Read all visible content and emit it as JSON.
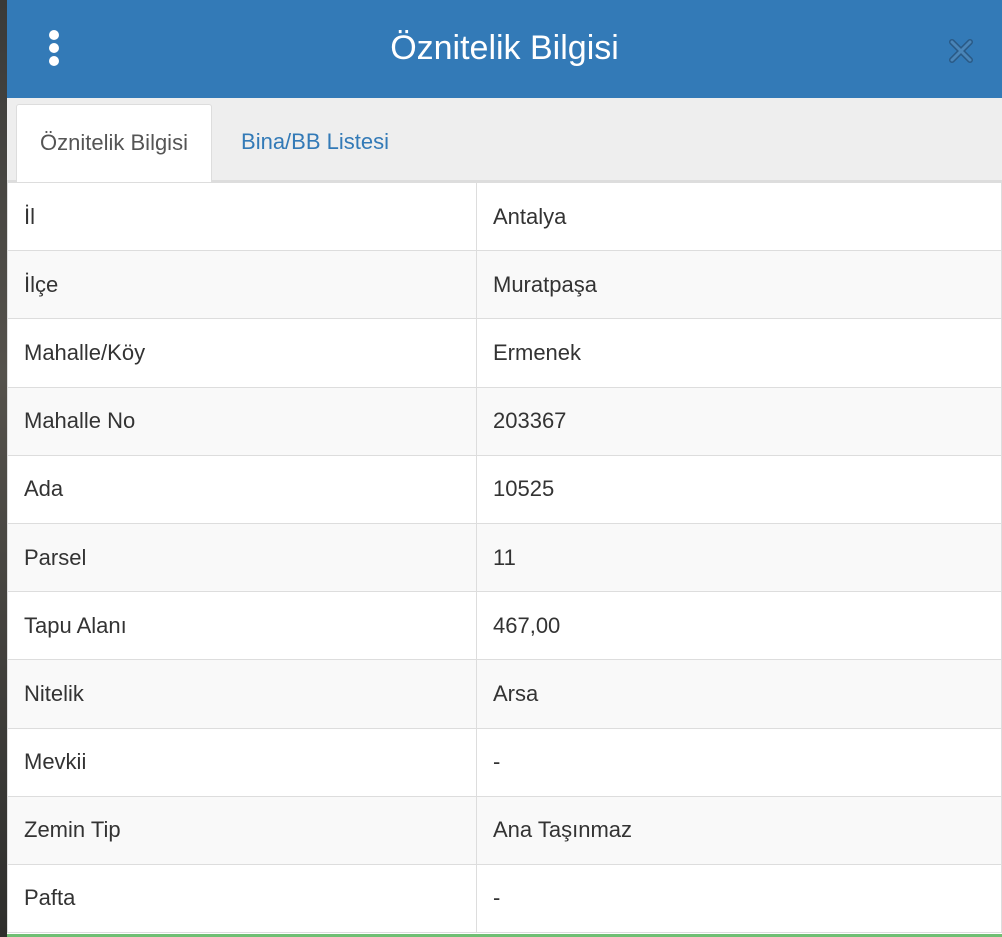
{
  "dialog": {
    "title": "Öznitelik Bilgisi",
    "menu_icon": "vertical-ellipsis-icon",
    "close_icon": "close-icon"
  },
  "tabs": [
    {
      "label": "Öznitelik Bilgisi",
      "active": true
    },
    {
      "label": "Bina/BB Listesi",
      "active": false
    }
  ],
  "attributes": [
    {
      "key": "İl",
      "value": "Antalya"
    },
    {
      "key": "İlçe",
      "value": "Muratpaşa"
    },
    {
      "key": "Mahalle/Köy",
      "value": "Ermenek"
    },
    {
      "key": "Mahalle No",
      "value": "203367"
    },
    {
      "key": "Ada",
      "value": "10525"
    },
    {
      "key": "Parsel",
      "value": "11"
    },
    {
      "key": "Tapu Alanı",
      "value": "467,00"
    },
    {
      "key": "Nitelik",
      "value": "Arsa"
    },
    {
      "key": "Mevkii",
      "value": "-"
    },
    {
      "key": "Zemin Tip",
      "value": "Ana Taşınmaz"
    },
    {
      "key": "Pafta",
      "value": "-"
    }
  ],
  "colors": {
    "header": "#337ab7",
    "tab_link": "#337ab7",
    "text": "#333333"
  }
}
